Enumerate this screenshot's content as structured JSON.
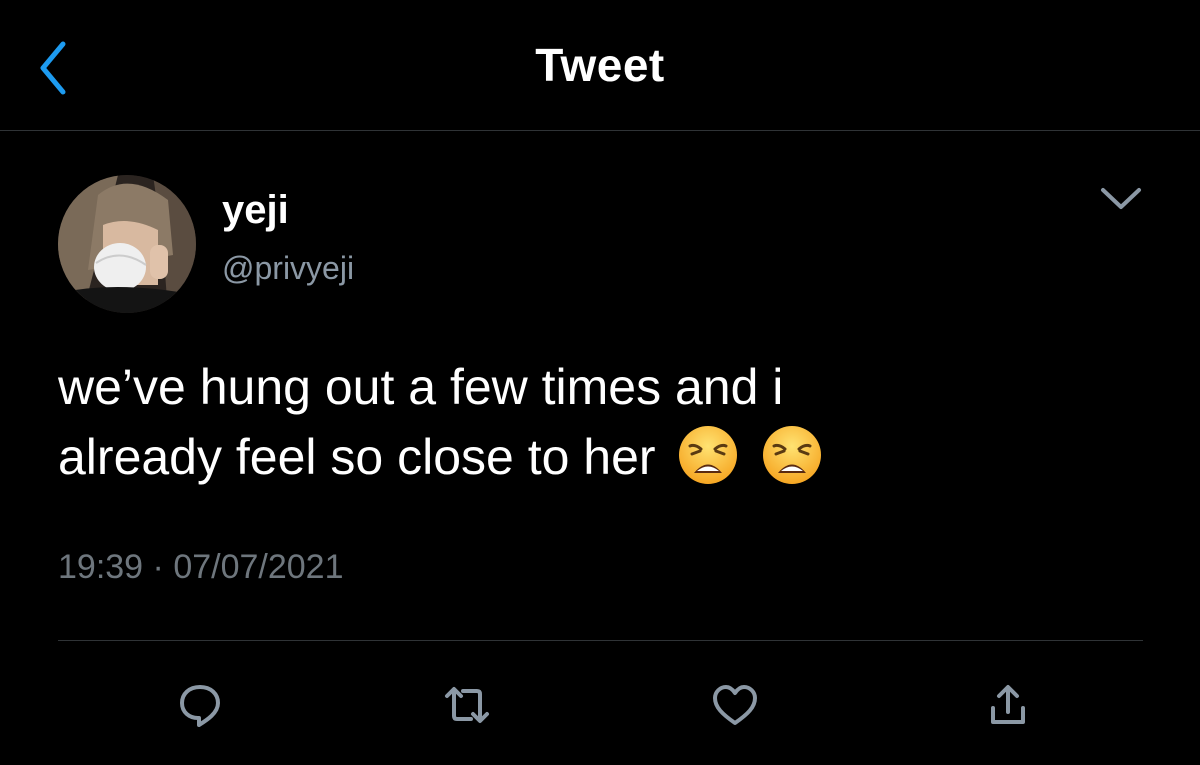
{
  "header": {
    "title": "Tweet",
    "back_icon": "chevron-left-icon",
    "accent_color": "#1d9bf0"
  },
  "tweet": {
    "author": {
      "display_name": "yeji",
      "handle": "@privyeji",
      "avatar": "profile-photo"
    },
    "text_lines": [
      "we’ve hung out a few times and i",
      "already feel so close to her"
    ],
    "emojis": [
      "😩",
      "😩"
    ],
    "time": "19:39",
    "separator": "·",
    "date": "07/07/2021",
    "menu_icon": "chevron-down-icon"
  },
  "actions": [
    {
      "icon": "reply-icon"
    },
    {
      "icon": "retweet-icon"
    },
    {
      "icon": "like-icon"
    },
    {
      "icon": "share-icon"
    }
  ],
  "colors": {
    "background": "#000000",
    "text": "#ffffff",
    "secondary_text": "#8b98a5",
    "divider": "#2f3336",
    "icon": "#8b98a5"
  }
}
